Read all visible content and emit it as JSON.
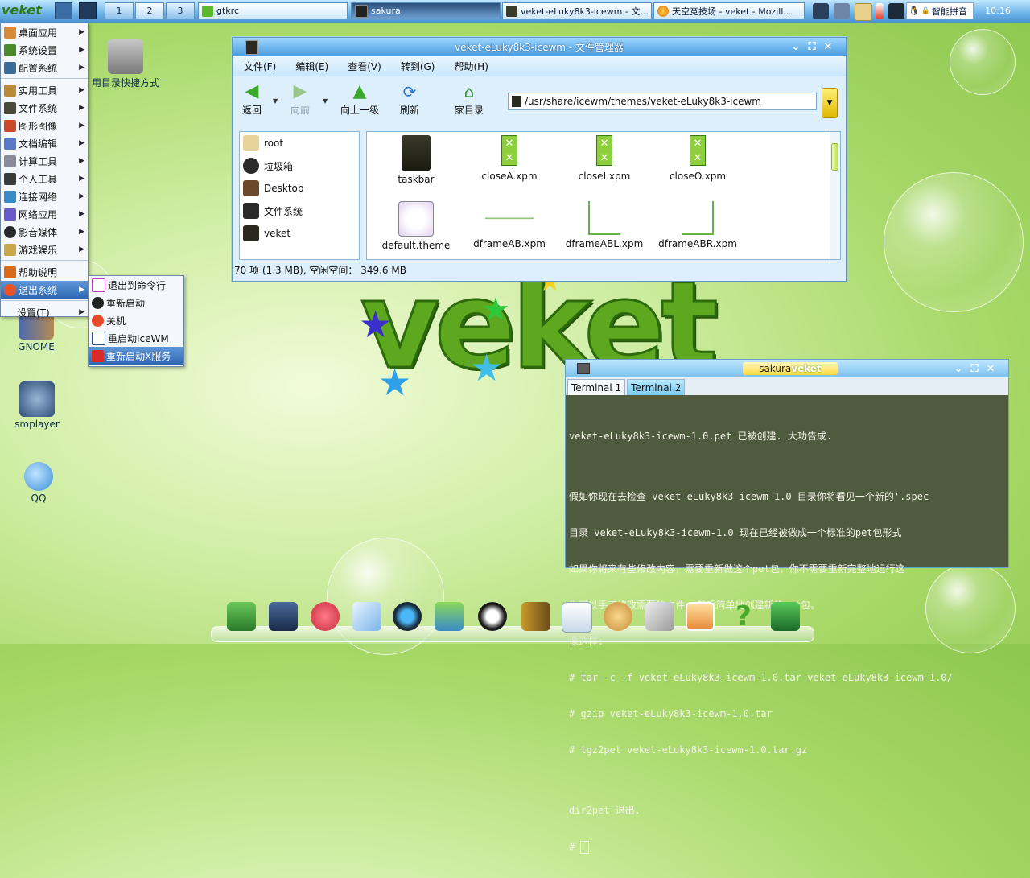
{
  "colors": {
    "taskbar": "#6db3e8",
    "menu_highlight": "#2d67b3",
    "terminal_bg": "#4f5b3f",
    "logo_green": "#5da81f"
  },
  "taskbar": {
    "logo": "veket",
    "workspaces": [
      "1",
      "2",
      "3"
    ],
    "tasks": [
      {
        "label": "gtkrc",
        "icon": "leaf-icon"
      },
      {
        "label": "sakura",
        "icon": "terminal-icon"
      },
      {
        "label": "veket-eLuky8k3-icewm - 文...",
        "icon": "folder-icon"
      },
      {
        "label": "天空竞技场 - veket - Mozill...",
        "icon": "firefox-icon"
      }
    ],
    "tray": {
      "ime": "智能拼音",
      "clock": "10:16"
    }
  },
  "start_menu": {
    "items": [
      {
        "label": "桌面应用",
        "icon": "desktop-app-icon"
      },
      {
        "label": "系统设置",
        "icon": "settings-icon"
      },
      {
        "label": "配置系统",
        "icon": "config-icon"
      },
      {
        "label": "实用工具",
        "icon": "tools-icon"
      },
      {
        "label": "文件系统",
        "icon": "filesystem-icon"
      },
      {
        "label": "图形图像",
        "icon": "graphics-icon"
      },
      {
        "label": "文档编辑",
        "icon": "document-icon"
      },
      {
        "label": "计算工具",
        "icon": "calculator-icon"
      },
      {
        "label": "个人工具",
        "icon": "personal-icon"
      },
      {
        "label": "连接网络",
        "icon": "connect-icon"
      },
      {
        "label": "网络应用",
        "icon": "network-icon"
      },
      {
        "label": "影音媒体",
        "icon": "media-icon"
      },
      {
        "label": "游戏娱乐",
        "icon": "games-icon"
      }
    ],
    "help": "帮助说明",
    "exit": "退出系统",
    "settings": "设置(T)",
    "submenu": [
      "退出到命令行",
      "重新启动",
      "关机",
      "重启动IceWM",
      "重新启动X服务"
    ]
  },
  "desktop_icons": {
    "shortcut": "用目录快捷方式",
    "gnome": "GNOME",
    "smplayer": "smplayer",
    "qq": "QQ"
  },
  "file_manager": {
    "title": "veket-eLuky8k3-icewm - 文件管理器",
    "menus": [
      "文件(F)",
      "编辑(E)",
      "查看(V)",
      "转到(G)",
      "帮助(H)"
    ],
    "toolbar": {
      "back": "返回",
      "forward": "向前",
      "up": "向上一级",
      "refresh": "刷新",
      "home": "家目录"
    },
    "path": "/usr/share/icewm/themes/veket-eLuky8k3-icewm",
    "places": [
      "root",
      "垃圾箱",
      "Desktop",
      "文件系统",
      "veket"
    ],
    "files": [
      "taskbar",
      "closeA.xpm",
      "closeI.xpm",
      "closeO.xpm",
      "default.theme",
      "dframeAB.xpm",
      "dframeABL.xpm",
      "dframeABR.xpm"
    ],
    "status": "70 项 (1.3 MB), 空闲空间： 349.6 MB"
  },
  "wallpaper_text": "veket",
  "terminal": {
    "title_a": "sakura",
    "title_b": "veket",
    "tabs": [
      "Terminal 1",
      "Terminal 2"
    ],
    "lines": [
      "veket-eLuky8k3-icewm-1.0.pet 已被创建. 大功告成.",
      "",
      "假如你现在去检查 veket-eLuky8k3-icewm-1.0 目录你将看见一个新的'.spec",
      "目录 veket-eLuky8k3-icewm-1.0 现在已经被做成一个标准的pet包形式",
      "如果你将来有些修改内容，需要重新做这个pet包，你不需要重新完整地运行这",
      "你可以手工修改需要的文件, 然后简单地创建新的pet包。",
      "像这样:",
      "# tar -c -f veket-eLuky8k3-icewm-1.0.tar veket-eLuky8k3-icewm-1.0/",
      "# gzip veket-eLuky8k3-icewm-1.0.tar",
      "# tgz2pet veket-eLuky8k3-icewm-1.0.tar.gz",
      "",
      "dir2pet 退出."
    ],
    "prompt": "# "
  },
  "dock": [
    "file-manager-icon",
    "monitor-icon",
    "hedgehog-icon",
    "editor-icon",
    "media-player-icon",
    "users-icon",
    "penguin-icon",
    "exit-door-icon",
    "chart-window-icon",
    "paint-palette-icon",
    "usb-drive-icon",
    "photo-icon",
    "help-icon",
    "camera-icon"
  ]
}
